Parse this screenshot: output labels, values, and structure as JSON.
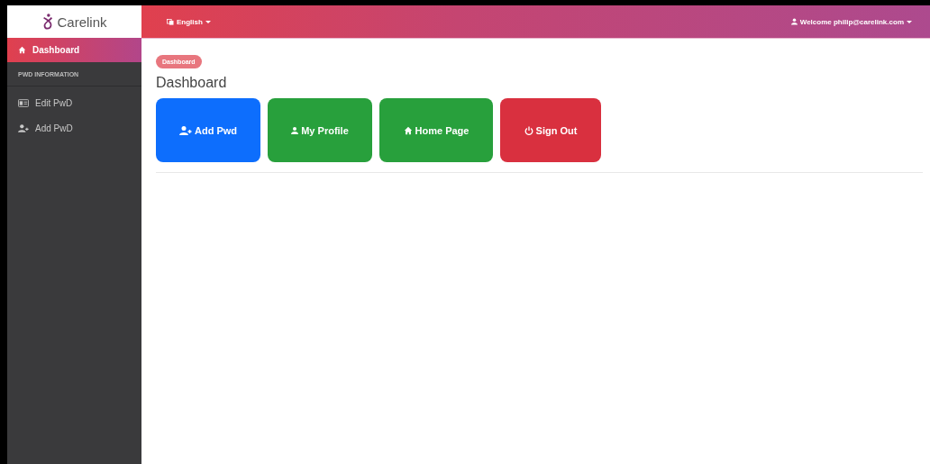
{
  "brand": {
    "name": "Carelink"
  },
  "topbar": {
    "language": "English",
    "user": "Welcome philip@carelink.com"
  },
  "sidebar": {
    "items": [
      {
        "label": "Dashboard",
        "kind": "home",
        "selected": true
      }
    ],
    "section": "PWD INFORMATION",
    "links": [
      {
        "label": "Edit PwD",
        "kind": "card",
        "selected": false
      },
      {
        "label": "Add PwD",
        "kind": "user-plus",
        "selected": false
      }
    ]
  },
  "breadcrumb": "Dashboard",
  "title": "Dashboard",
  "actions": [
    {
      "label": "Add Pwd",
      "kind": "user-plus",
      "color": "#0d6efd"
    },
    {
      "label": "My Profile",
      "kind": "user",
      "color": "#28a03c"
    },
    {
      "label": "Home Page",
      "kind": "home",
      "color": "#28a03c"
    },
    {
      "label": "Sign Out",
      "kind": "power",
      "color": "#d9303f"
    }
  ]
}
